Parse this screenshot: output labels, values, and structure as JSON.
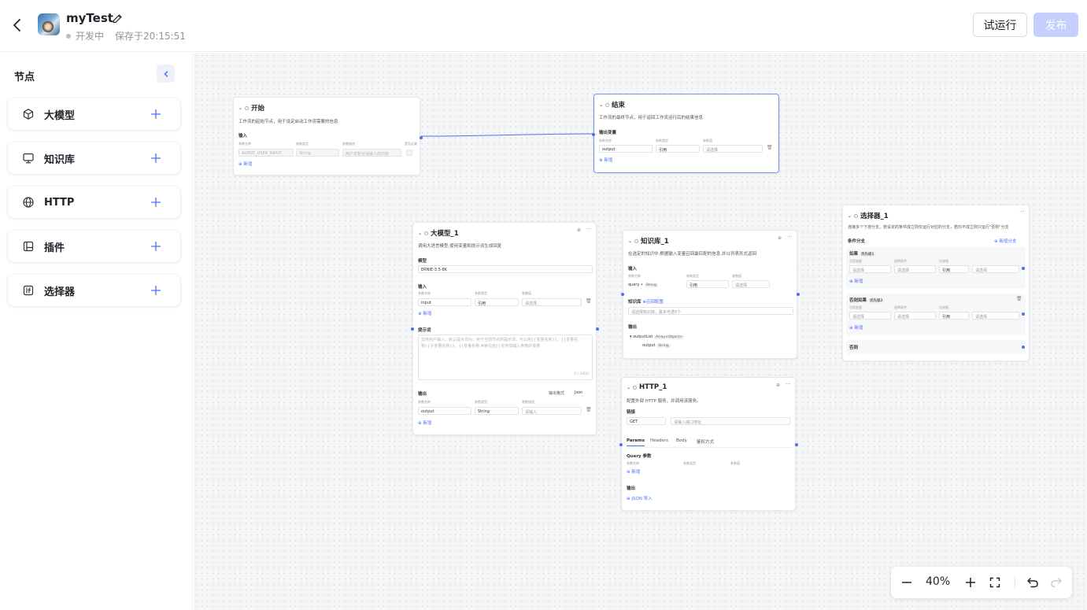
{
  "header": {
    "title": "myTest",
    "status": "开发中",
    "saved": "保存于20:15:51",
    "run_label": "试运行",
    "publish_label": "发布"
  },
  "sidebar": {
    "title": "节点",
    "items": [
      {
        "label": "大模型",
        "icon": "cube-icon"
      },
      {
        "label": "知识库",
        "icon": "monitor-icon"
      },
      {
        "label": "HTTP",
        "icon": "globe-icon"
      },
      {
        "label": "插件",
        "icon": "layout-icon"
      },
      {
        "label": "选择器",
        "icon": "if-icon"
      }
    ]
  },
  "nodes": {
    "start": {
      "title": "开始",
      "desc": "工作流的起始节点，用于设定启动工作流需要的信息",
      "input_label": "输入",
      "col1": "参数名称",
      "col2": "参数类型",
      "col3": "参数描述",
      "col4": "是否必要",
      "param_name": "AGENT_USER_INPUT",
      "param_type": "String",
      "param_desc": "用户本轮对话输入的内容",
      "add": "新增"
    },
    "end": {
      "title": "结束",
      "desc": "工作流的最终节点，用于返回工作流运行后的结果信息",
      "output_label": "输出变量",
      "col1": "参数名称",
      "col2": "参数类型",
      "col3": "参数值",
      "param_name": "output",
      "param_type": "引用",
      "param_value": "请选择",
      "add": "新增"
    },
    "llm": {
      "title": "大模型_1",
      "desc": "调用大语言模型,使用变量和提示词生成回复",
      "model_label": "模型",
      "model_value": "ERNIE-3.5-8K",
      "input_label": "输入",
      "col1": "参数名称",
      "col2": "参数类型",
      "col3": "参数值",
      "param_name": "input",
      "param_type": "引用",
      "param_value": "请选择",
      "add": "新增",
      "prompt_label": "提示词",
      "prompt_line1": "支持用户输入。默认提示词为：用于当前节点的提示词，可以用{{变量名称}}。{{变量名",
      "prompt_line2": "称}}子变量名称{}，{{变量名称.#索引值}}在环境输入参数的变量",
      "prompt_counter": "0 / 3000",
      "output_label": "输出",
      "output_format_label": "输出格式",
      "output_format_value": "Json",
      "out_col1": "参数名称",
      "out_col2": "参数类型",
      "out_col3": "参数描述",
      "out_name": "output",
      "out_type": "String",
      "out_desc": "请输入",
      "out_add": "新增"
    },
    "kb": {
      "title": "知识库_1",
      "desc": "在选定的知识中,根据输入变量召回最匹配的信息,并以列表形式返回",
      "input_label": "输入",
      "col1": "参数名称",
      "col2": "参数类型",
      "col3": "参数值",
      "param_name": "query",
      "param_tag": "String",
      "param_type": "引用",
      "param_value": "请选择",
      "kb_label": "知识库",
      "kb_config": "召回配置",
      "kb_placeholder": "请选择知识库，最多可选5个",
      "output_label": "输出",
      "out1_name": "outputList",
      "out1_tag": "Array<Object>",
      "out2_name": "output",
      "out2_tag": "String"
    },
    "selector": {
      "title": "选择器_1",
      "desc": "连接多个下游分支，若设定的条件成立则仅运行对应的分支，若均不成立则只运行\"否则\"分支",
      "branch_label": "条件分支",
      "add_branch": "新增分支",
      "if_label": "如果",
      "if_tag": "优先级1",
      "elif_label": "否则如果",
      "elif_tag": "优先级2",
      "col1": "引用变量",
      "col2": "选择条件",
      "col3": "比较值",
      "placeholder": "请选择",
      "ref": "引用",
      "add": "新增",
      "else_label": "否则"
    },
    "http": {
      "title": "HTTP_1",
      "desc": "配置外部 HTTP 服务，并调用该服务。",
      "link_label": "链接",
      "method": "GET",
      "url_placeholder": "请输入接口地址",
      "tabs": [
        "Params",
        "Headers",
        "Body",
        "鉴权方式"
      ],
      "query_label": "Query 参数",
      "col1": "参数名称",
      "col2": "参数类型",
      "col3": "参数值",
      "add": "新增",
      "output_label": "输出",
      "json_import": "JSON 导入"
    }
  },
  "zoom": {
    "level": "40%"
  }
}
